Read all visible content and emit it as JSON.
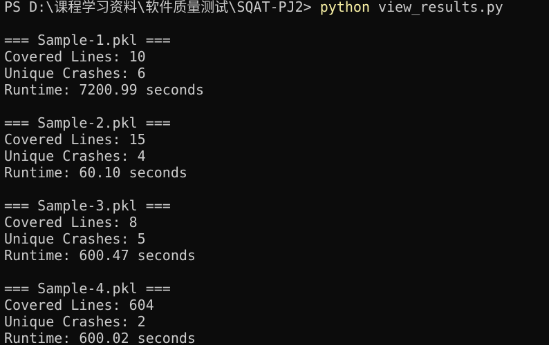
{
  "prompt": {
    "text": "PS D:\\课程学习资料\\软件质量测试\\SQAT-PJ2> ",
    "command": "python",
    "args": " view_results.py"
  },
  "results": [
    {
      "header": "=== Sample-1.pkl ===",
      "covered": "Covered Lines: 10",
      "crashes": "Unique Crashes: 6",
      "runtime": "Runtime: 7200.99 seconds"
    },
    {
      "header": "=== Sample-2.pkl ===",
      "covered": "Covered Lines: 15",
      "crashes": "Unique Crashes: 4",
      "runtime": "Runtime: 60.10 seconds"
    },
    {
      "header": "=== Sample-3.pkl ===",
      "covered": "Covered Lines: 8",
      "crashes": "Unique Crashes: 5",
      "runtime": "Runtime: 600.47 seconds"
    },
    {
      "header": "=== Sample-4.pkl ===",
      "covered": "Covered Lines: 604",
      "crashes": "Unique Crashes: 2",
      "runtime": "Runtime: 600.02 seconds"
    }
  ],
  "colors": {
    "background": "#0c0c0c",
    "text": "#cccccc",
    "command": "#f9f1a5"
  }
}
